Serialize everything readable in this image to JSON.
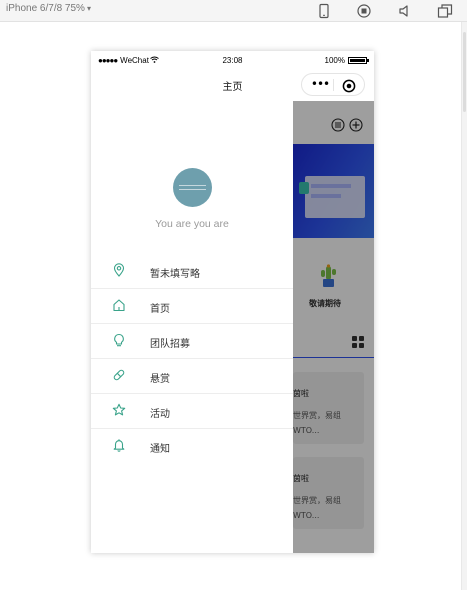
{
  "devtools": {
    "device_label": "iPhone 6/7/8 75%",
    "icons": [
      "phone-icon",
      "record-icon",
      "sound-icon",
      "window-icon"
    ]
  },
  "statusbar": {
    "carrier": "WeChat",
    "time": "23:08",
    "battery": "100%"
  },
  "navbar": {
    "title": "主页",
    "more_glyph": "•••"
  },
  "drawer": {
    "username": "You are you are",
    "menu": [
      {
        "label": "暂未填写略",
        "icon": "location-pin-icon"
      },
      {
        "label": "首页",
        "icon": "home-icon"
      },
      {
        "label": "团队招募",
        "icon": "lightbulb-icon"
      },
      {
        "label": "悬赏",
        "icon": "pill-icon"
      },
      {
        "label": "活动",
        "icon": "star-icon"
      },
      {
        "label": "通知",
        "icon": "bell-icon"
      }
    ]
  },
  "background_page": {
    "badge_label": "敬请期待",
    "cards": [
      {
        "title": "茵啦",
        "line1": "世界赏，易组",
        "line2": "WTO..."
      },
      {
        "title": "茵啦",
        "line1": "世界赏，易组",
        "line2": "WTO..."
      }
    ]
  },
  "colors": {
    "accent_blue": "#2e52f2",
    "avatar": "#6e9fad",
    "icon_green": "#3aa38a"
  }
}
